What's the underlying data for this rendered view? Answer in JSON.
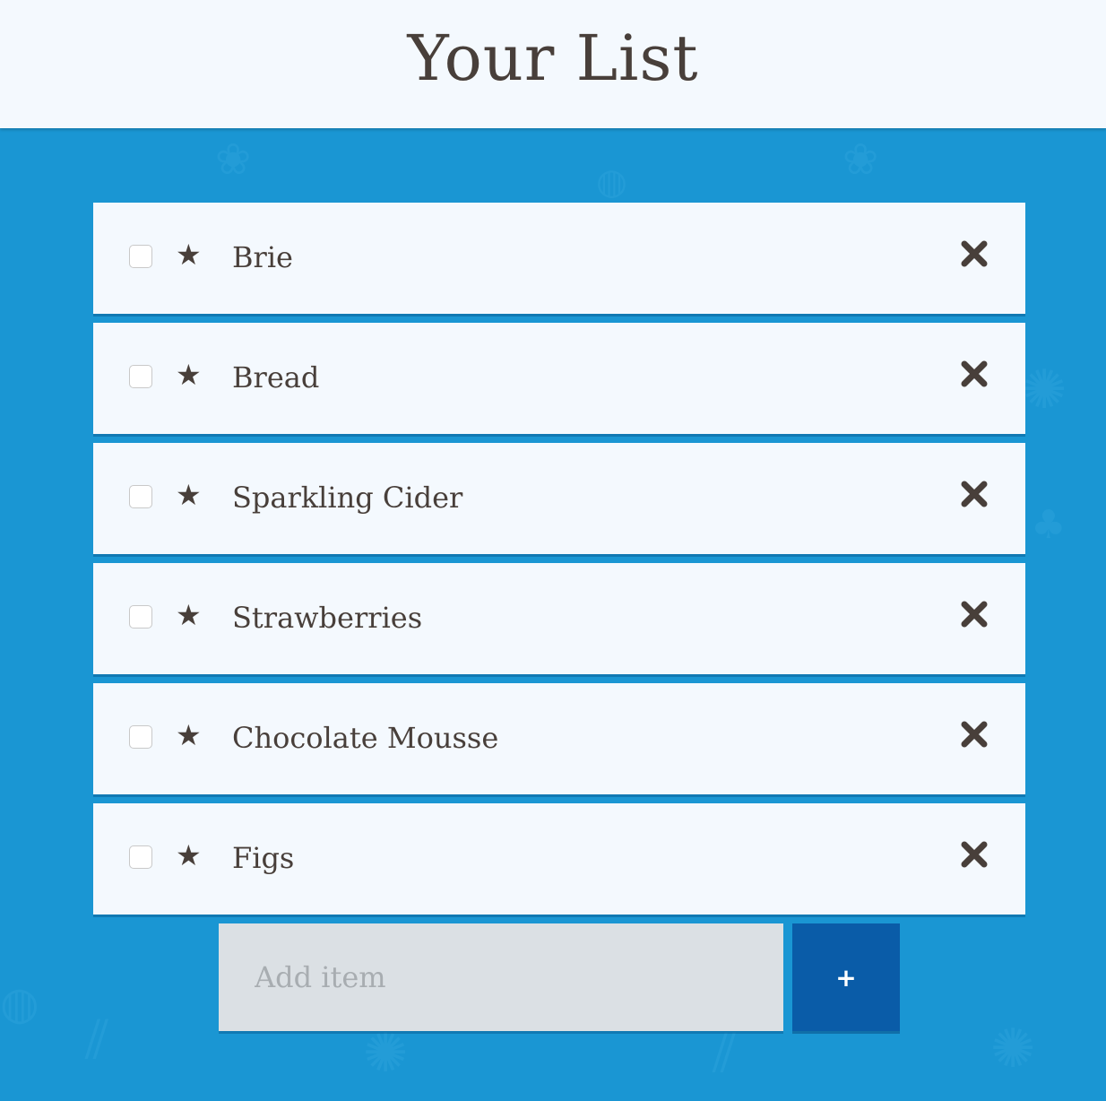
{
  "header": {
    "title": "Your List"
  },
  "colors": {
    "background": "#1a96d3",
    "card": "#f4f9fe",
    "text": "#483f3a",
    "input_bg": "#dbe0e4",
    "add_button": "#0a5ca8"
  },
  "list": {
    "items": [
      {
        "label": "Brie",
        "checked": false,
        "star_icon": "star-icon",
        "delete_icon": "close-icon"
      },
      {
        "label": "Bread",
        "checked": false,
        "star_icon": "star-icon",
        "delete_icon": "close-icon"
      },
      {
        "label": "Sparkling Cider",
        "checked": false,
        "star_icon": "star-icon",
        "delete_icon": "close-icon"
      },
      {
        "label": "Strawberries",
        "checked": false,
        "star_icon": "star-icon",
        "delete_icon": "close-icon"
      },
      {
        "label": "Chocolate Mousse",
        "checked": false,
        "star_icon": "star-icon",
        "delete_icon": "close-icon"
      },
      {
        "label": "Figs",
        "checked": false,
        "star_icon": "star-icon",
        "delete_icon": "close-icon"
      }
    ]
  },
  "add_form": {
    "placeholder": "Add item",
    "value": "",
    "button_label": "+"
  }
}
